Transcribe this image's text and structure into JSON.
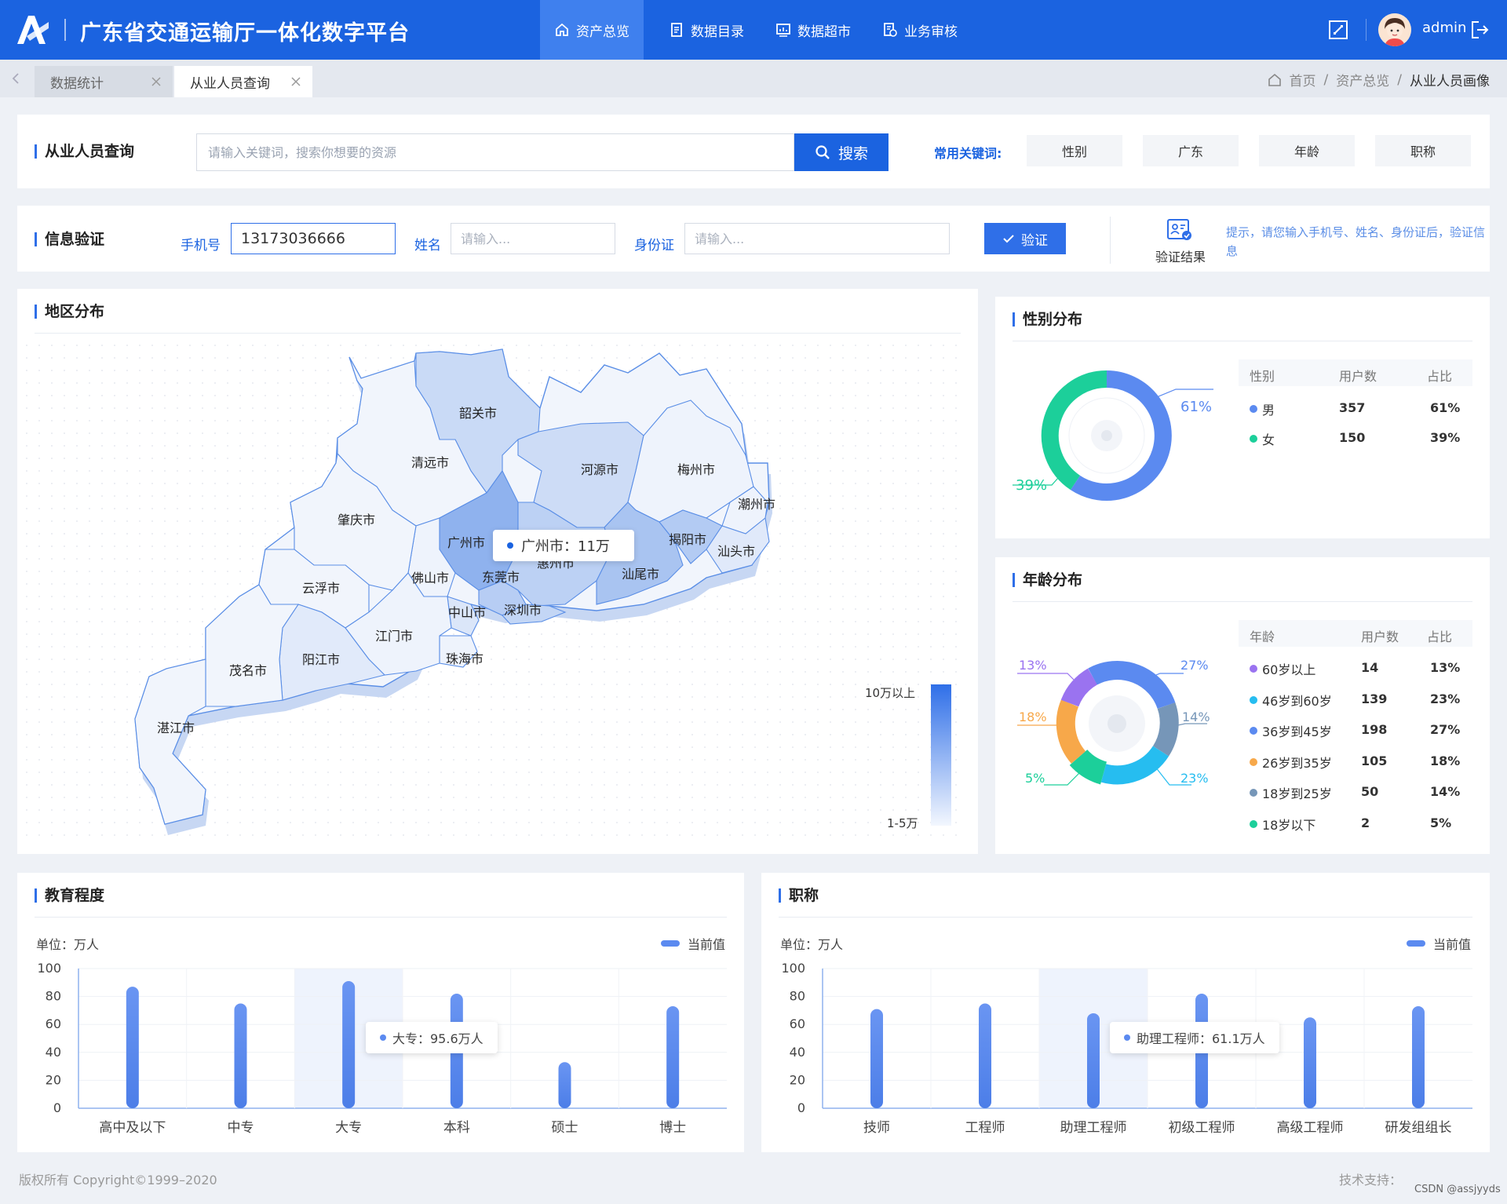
{
  "header": {
    "app_title": "广东省交通运输厅一体化数字平台",
    "nav": [
      {
        "label": "资产总览",
        "icon": "home-icon",
        "active": true
      },
      {
        "label": "数据目录",
        "icon": "document-icon",
        "active": false
      },
      {
        "label": "数据超市",
        "icon": "chart-board-icon",
        "active": false
      },
      {
        "label": "业务审核",
        "icon": "audit-icon",
        "active": false
      }
    ],
    "username": "admin"
  },
  "tabs": [
    {
      "label": "数据统计",
      "active": false
    },
    {
      "label": "从业人员查询",
      "active": true
    }
  ],
  "breadcrumb": [
    "首页",
    "资产总览",
    "从业人员画像"
  ],
  "search_card": {
    "title": "从业人员查询",
    "placeholder": "请输入关键词，搜索你想要的资源",
    "button": "搜索",
    "keywords_label": "常用关键词:",
    "keywords": [
      "性别",
      "广东",
      "年龄",
      "职称"
    ]
  },
  "verify_card": {
    "title": "信息验证",
    "phone_label": "手机号",
    "phone_value": "13173036666",
    "name_label": "姓名",
    "name_placeholder": "请输入...",
    "id_label": "身份证",
    "id_placeholder": "请输入...",
    "button": "验证",
    "result_label": "验证结果",
    "hint": "提示，请您输入手机号、姓名、身份证后，验证信息"
  },
  "region_card": {
    "title": "地区分布",
    "cities": [
      "韶关市",
      "清远市",
      "河源市",
      "梅州市",
      "潮州市",
      "肇庆市",
      "广州市",
      "揭阳市",
      "汕头市",
      "惠州市",
      "佛山市",
      "东莞市",
      "汕尾市",
      "云浮市",
      "中山市",
      "深圳市",
      "江门市",
      "阳江市",
      "茂名市",
      "珠海市",
      "湛江市"
    ],
    "tooltip": "广州市：11万",
    "legend_high": "10万以上",
    "legend_low": "1-5万"
  },
  "gender_card": {
    "title": "性别分布",
    "headers": [
      "性别",
      "用户数",
      "占比"
    ],
    "rows": [
      {
        "label": "男",
        "count": "357",
        "pct": "61%",
        "color": "#5b8af0"
      },
      {
        "label": "女",
        "count": "150",
        "pct": "39%",
        "color": "#1ccf9a"
      }
    ],
    "callout_male": "61%",
    "callout_female": "39%"
  },
  "age_card": {
    "title": "年龄分布",
    "headers": [
      "年龄",
      "用户数",
      "占比"
    ],
    "rows": [
      {
        "label": "60岁以上",
        "count": "14",
        "pct": "13%",
        "color": "#9a73f0"
      },
      {
        "label": "46岁到60岁",
        "count": "139",
        "pct": "23%",
        "color": "#26bdf0"
      },
      {
        "label": "36岁到45岁",
        "count": "198",
        "pct": "27%",
        "color": "#5b8af0"
      },
      {
        "label": "26岁到35岁",
        "count": "105",
        "pct": "18%",
        "color": "#f7a84a"
      },
      {
        "label": "18岁到25岁",
        "count": "50",
        "pct": "14%",
        "color": "#7696b8"
      },
      {
        "label": "18岁以下",
        "count": "2",
        "pct": "5%",
        "color": "#1ccf9a"
      }
    ]
  },
  "chart_data": [
    {
      "type": "bar",
      "title": "教育程度",
      "unit_label": "单位：万人",
      "legend": "当前值",
      "categories": [
        "高中及以下",
        "中专",
        "大专",
        "本科",
        "硕士",
        "博士"
      ],
      "series": [
        {
          "name": "当前值",
          "values": [
            87,
            75,
            91,
            82,
            33,
            73
          ]
        }
      ],
      "yticks": [
        "100",
        "80",
        "60",
        "40",
        "20",
        "0"
      ],
      "ylim": [
        0,
        100
      ],
      "highlight_index": 2,
      "tooltip": "大专：95.6万人"
    },
    {
      "type": "bar",
      "title": "职称",
      "unit_label": "单位：万人",
      "legend": "当前值",
      "categories": [
        "技师",
        "工程师",
        "助理工程师",
        "初级工程师",
        "高级工程师",
        "研发组组长"
      ],
      "series": [
        {
          "name": "当前值",
          "values": [
            71,
            75,
            68,
            82,
            65,
            73
          ]
        }
      ],
      "yticks": [
        "100",
        "80",
        "60",
        "40",
        "20",
        "0"
      ],
      "ylim": [
        0,
        100
      ],
      "highlight_index": 2,
      "tooltip": "助理工程师：61.1万人"
    }
  ],
  "footer": {
    "copyright": "版权所有 Copyright©1999–2020",
    "support": "技术支持：",
    "watermark": "CSDN @assjyyds"
  }
}
